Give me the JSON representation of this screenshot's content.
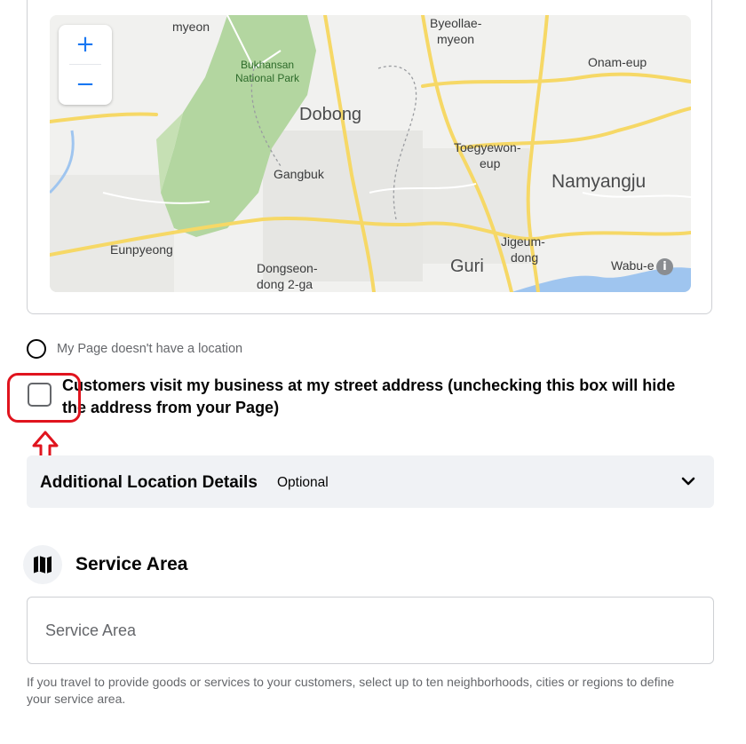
{
  "map": {
    "zoom_in": "+",
    "zoom_out": "−",
    "info": "i",
    "labels": {
      "myeon": "myeon",
      "byeollae": "Byeollae-",
      "byeollae2": "myeon",
      "onam": "Onam-eup",
      "bukhansan": "Bukhansan",
      "bukhansan2": "National Park",
      "dobong": "Dobong",
      "toegyewon": "Toegyewon-",
      "toegyewon2": "eup",
      "gangbuk": "Gangbuk",
      "namyangju": "Namyangju",
      "eunpyeong": "Eunpyeong",
      "jigeum": "Jigeum-",
      "jigeum2": "dong",
      "dongseon": "Dongseon-",
      "dongseon2": "dong 2-ga",
      "guri": "Guri",
      "wabu": "Wabu-e"
    }
  },
  "location_option": {
    "no_location_label": "My Page doesn't have a location",
    "street_address_label": "Customers visit my business at my street address (unchecking this box will hide the address from your Page)"
  },
  "additional_details": {
    "title": "Additional Location Details",
    "optional": "Optional"
  },
  "service_area": {
    "title": "Service Area",
    "placeholder": "Service Area",
    "help": "If you travel to provide goods or services to your customers, select up to ten neighborhoods, cities or regions to define your service area."
  },
  "colors": {
    "accent": "#1877f2",
    "highlight": "#e0141e",
    "park": "#a8d08d",
    "road": "#f6d866"
  }
}
